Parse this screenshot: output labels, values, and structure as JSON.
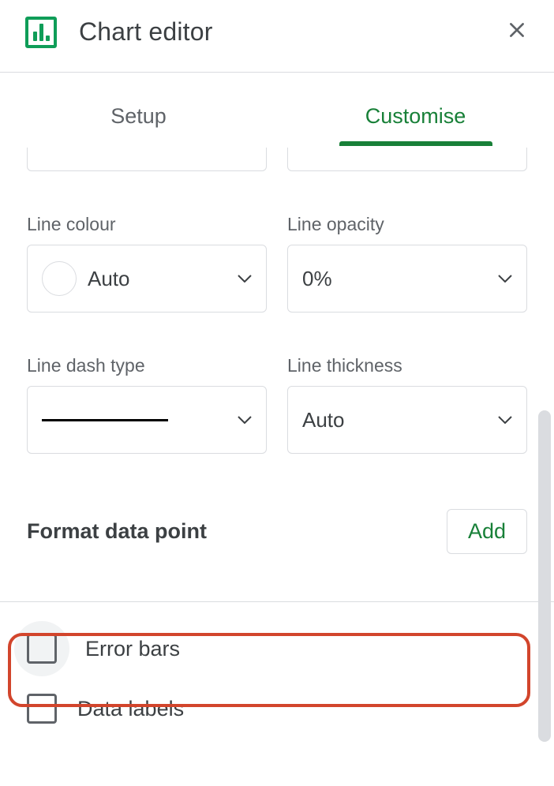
{
  "header": {
    "title": "Chart editor"
  },
  "tabs": {
    "setup": "Setup",
    "customise": "Customise"
  },
  "fields": {
    "line_colour": {
      "label": "Line colour",
      "value": "Auto"
    },
    "line_opacity": {
      "label": "Line opacity",
      "value": "0%"
    },
    "line_dash_type": {
      "label": "Line dash type"
    },
    "line_thickness": {
      "label": "Line thickness",
      "value": "Auto"
    }
  },
  "format_data_point": {
    "label": "Format data point",
    "button": "Add"
  },
  "checkboxes": {
    "error_bars": "Error bars",
    "data_labels": "Data labels"
  }
}
